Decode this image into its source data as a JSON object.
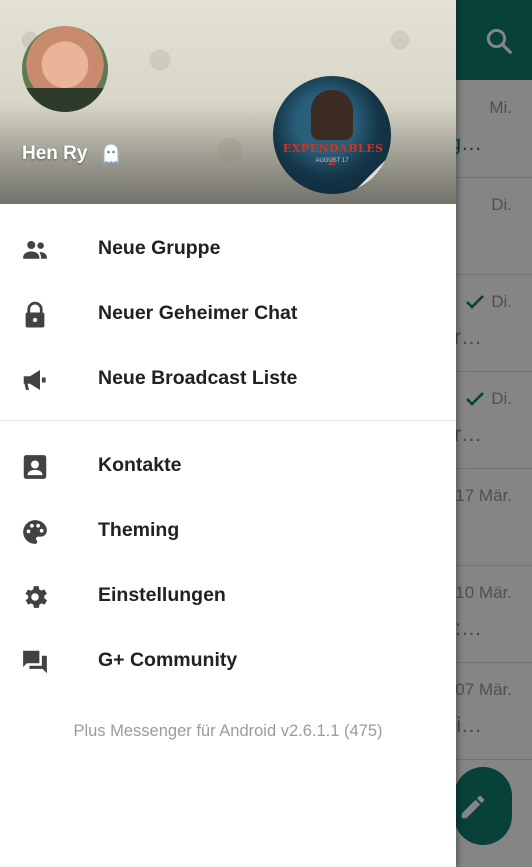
{
  "profile": {
    "name": "Hen Ry"
  },
  "menu": {
    "new_group": "Neue Gruppe",
    "new_secret_chat": "Neuer Geheimer Chat",
    "new_broadcast": "Neue Broadcast Liste",
    "contacts": "Kontakte",
    "theming": "Theming",
    "settings": "Einstellungen",
    "community": "G+ Community"
  },
  "footer": {
    "version": "Plus Messenger für Android v2.6.1.1 (475)"
  },
  "channel_avatar": {
    "title": "EXPENDABLES 2",
    "subtitle": "AUGUST 17"
  },
  "background_list": {
    "rows": [
      {
        "date": "Mi.",
        "message": "g…"
      },
      {
        "date": "Di.",
        "message": ""
      },
      {
        "date": "Di.",
        "message": "gr…"
      },
      {
        "date": "Di.",
        "message": "gr…"
      },
      {
        "date": "17 Mär.",
        "message": ""
      },
      {
        "date": "10 Mär.",
        "message": ":…"
      },
      {
        "date": "07 Mär.",
        "message": "ei…"
      }
    ]
  },
  "colors": {
    "primary": "#0f7d6f",
    "icon": "#424242",
    "text": "#212121",
    "secondary_text": "#9b9b9b"
  },
  "icons": {
    "new_group": "group-icon",
    "new_secret_chat": "lock-icon",
    "new_broadcast": "megaphone-icon",
    "contacts": "contact-card-icon",
    "theming": "palette-icon",
    "settings": "gear-icon",
    "community": "forum-icon",
    "search": "search-icon",
    "compose": "pencil-icon"
  }
}
